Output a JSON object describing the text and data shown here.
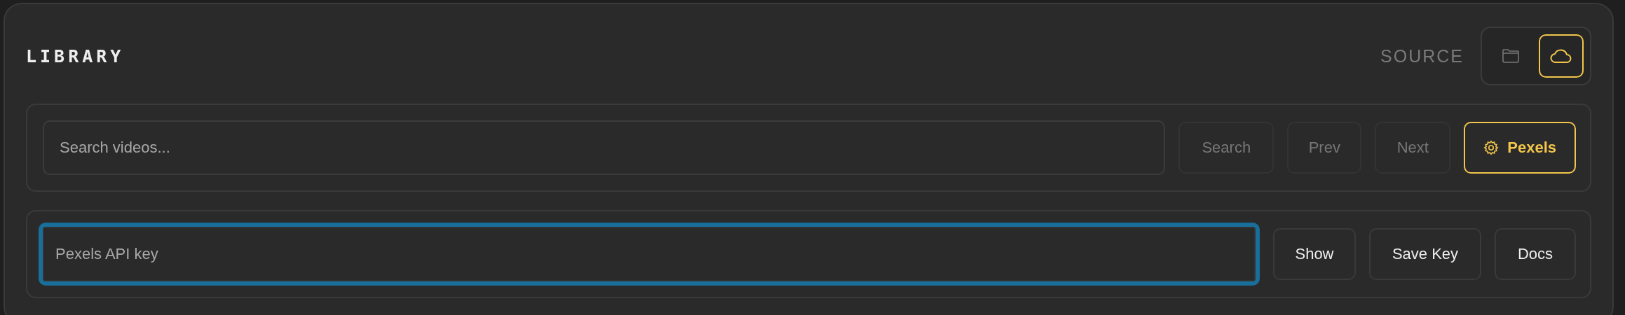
{
  "header": {
    "title": "LIBRARY",
    "source_label": "SOURCE",
    "sources": [
      {
        "kind": "folder",
        "selected": false
      },
      {
        "kind": "cloud",
        "selected": true
      }
    ]
  },
  "search_bar": {
    "placeholder": "Search videos...",
    "buttons": [
      {
        "label": "Search",
        "disabled": true,
        "kind": "plain",
        "active": false
      },
      {
        "label": "Prev",
        "disabled": true,
        "kind": "plain",
        "active": false
      },
      {
        "label": "Next",
        "disabled": true,
        "kind": "plain",
        "active": false
      },
      {
        "label": "Pexels",
        "disabled": false,
        "kind": "settings",
        "active": true
      }
    ]
  },
  "key_bar": {
    "placeholder": "Pexels API key",
    "focused": true,
    "buttons": [
      {
        "label": "Show",
        "disabled": false
      },
      {
        "label": "Save Key",
        "disabled": false
      },
      {
        "label": "Docs",
        "disabled": false
      }
    ]
  }
}
